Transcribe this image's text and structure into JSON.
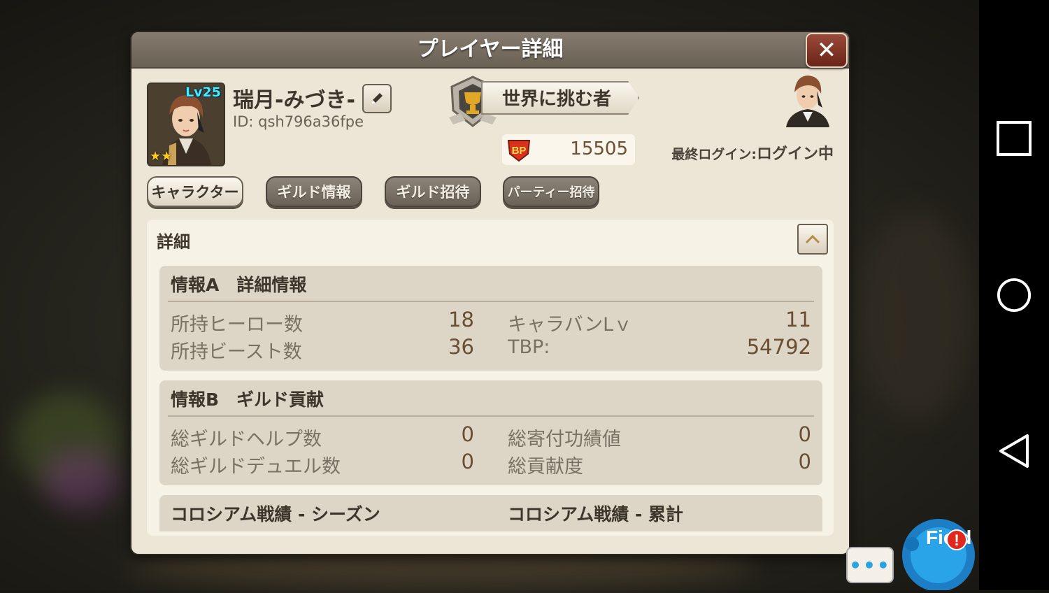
{
  "dialog": {
    "title": "プレイヤー詳細"
  },
  "player": {
    "level": "Lv25",
    "name": "瑞月-みづき-",
    "id": "ID: qsh796a36fpe",
    "title": "世界に挑む者",
    "bp_label": "BP",
    "bp": "15505",
    "last_login_label": "最終ログイン:",
    "last_login_value": "ログイン中"
  },
  "tabs": [
    {
      "label": "キャラクター"
    },
    {
      "label": "ギルド情報"
    },
    {
      "label": "ギルド招待"
    },
    {
      "label": "パーティー招待"
    }
  ],
  "detail": {
    "title": "詳細",
    "sections": [
      {
        "title": "情報A　詳細情報",
        "stats": [
          {
            "label": "所持ヒーロー数",
            "value": "18"
          },
          {
            "label": "所持ビースト数",
            "value": "36"
          },
          {
            "label": "キャラバンLｖ",
            "value": "11"
          },
          {
            "label": "TBP:",
            "value": "54792"
          }
        ]
      },
      {
        "title": "情報B　ギルド貢献",
        "stats": [
          {
            "label": "総ギルドヘルプ数",
            "value": "0"
          },
          {
            "label": "総ギルドデュエル数",
            "value": "0"
          },
          {
            "label": "総寄付功績値",
            "value": "0"
          },
          {
            "label": "総貢献度",
            "value": "0"
          }
        ]
      },
      {
        "title_left": "コロシアム戦績 - シーズン",
        "title_right": "コロシアム戦績 - 累計"
      }
    ]
  },
  "hud": {
    "chat_label": "•••",
    "field_label": "Field",
    "alert": "!"
  },
  "colors": {
    "accent_cyan": "#3cf2ff",
    "bp_red": "#d8321e",
    "close_red": "#7a2e20"
  }
}
